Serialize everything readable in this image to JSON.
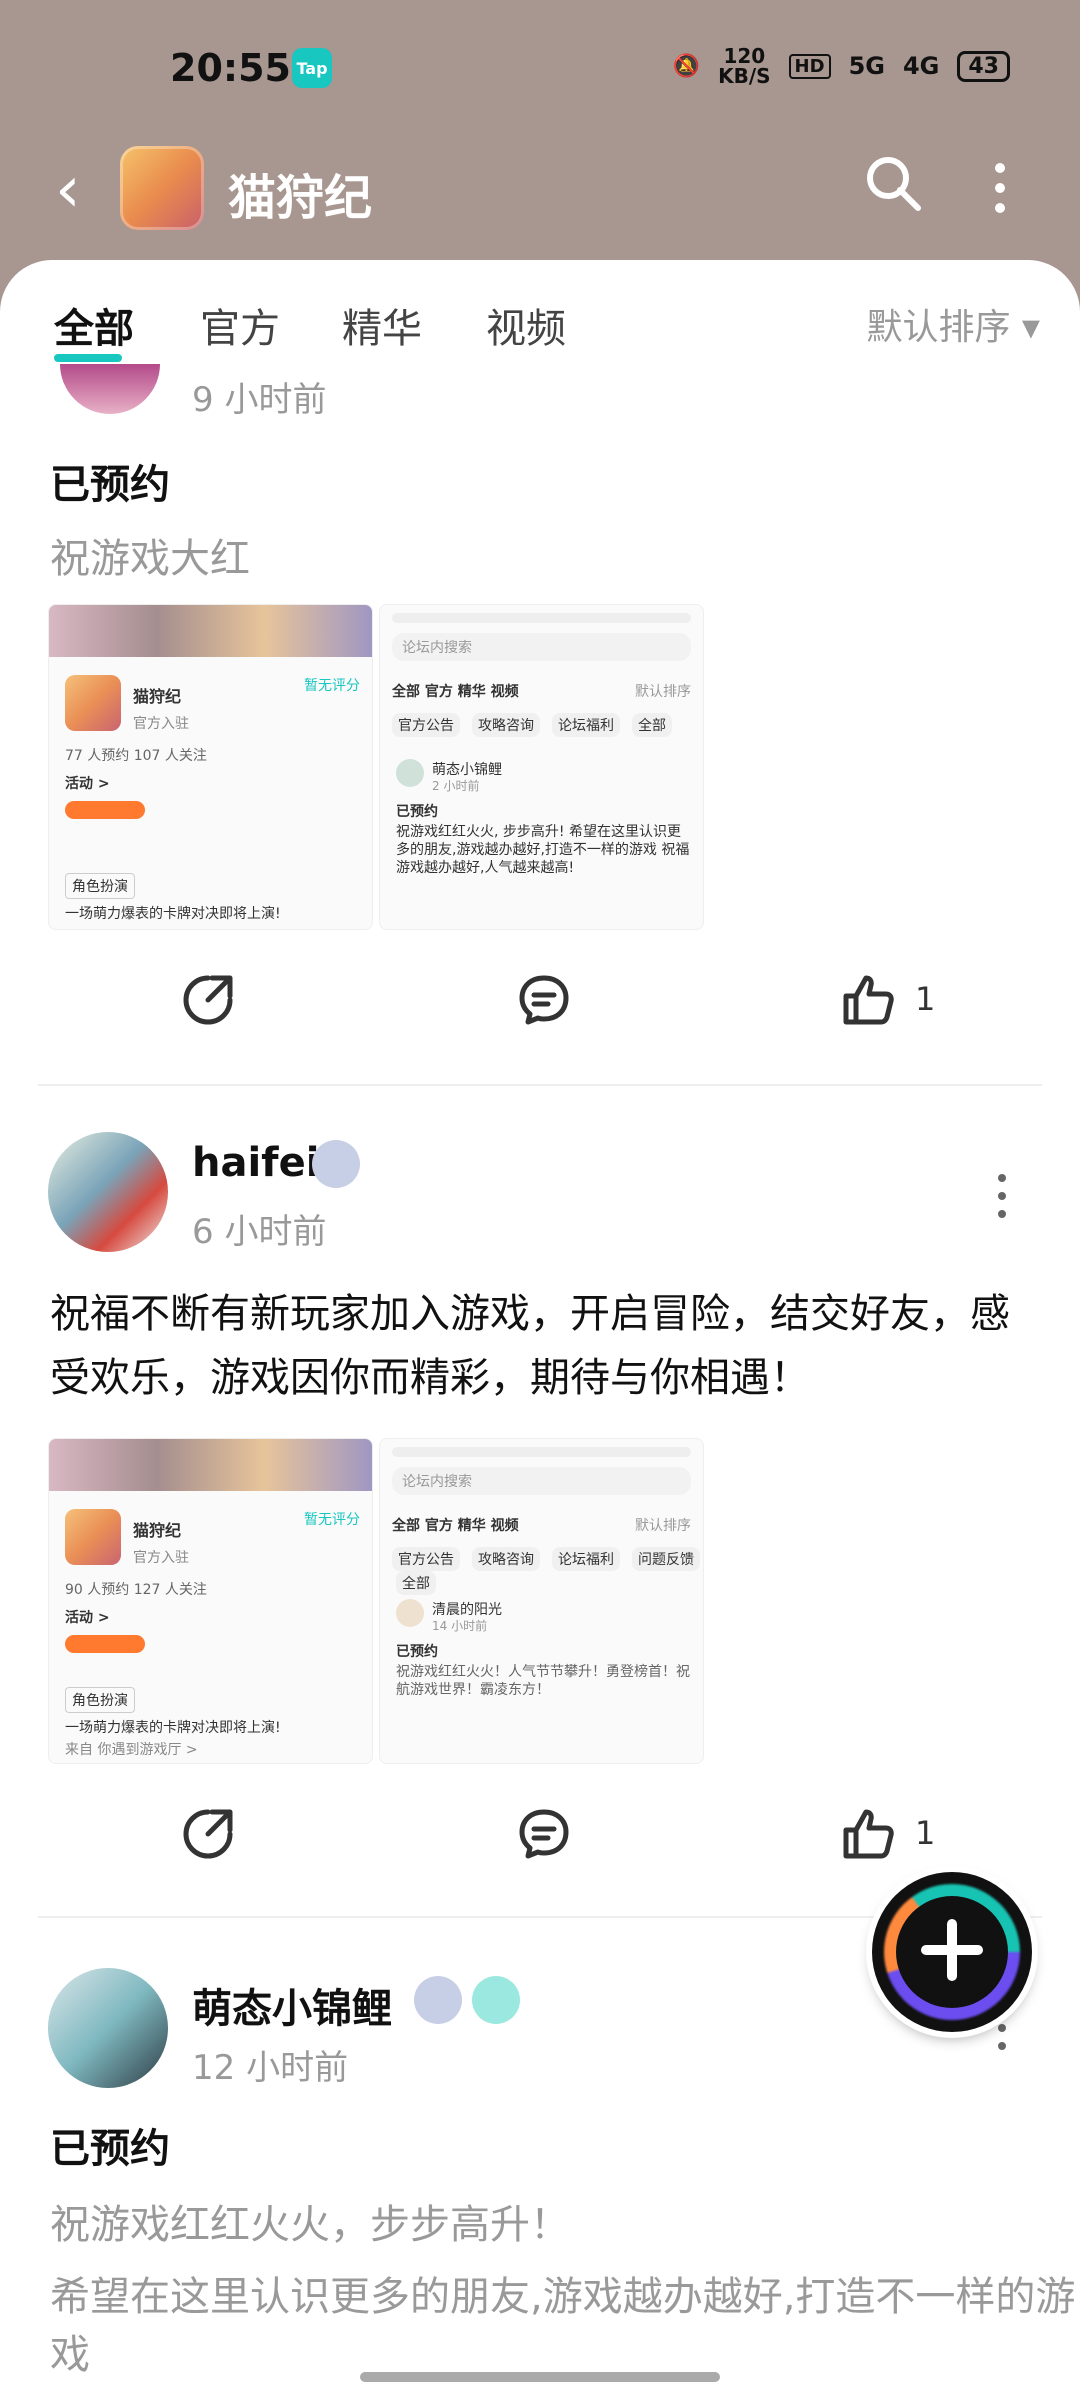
{
  "status": {
    "time": "20:55",
    "tap_badge": "Tap",
    "speed_top": "120",
    "speed_unit": "KB/S",
    "hd_label": "HD",
    "signal1": "5G",
    "signal2": "4G",
    "battery": "43"
  },
  "header": {
    "title": "猫狩纪"
  },
  "tabs": [
    {
      "label": "全部"
    },
    {
      "label": "官方"
    },
    {
      "label": "精华"
    },
    {
      "label": "视频"
    }
  ],
  "sort_label": "默认排序",
  "posts": [
    {
      "time": "9 小时前",
      "title": "已预约",
      "body": "祝游戏大红",
      "like_count": "1",
      "thumb_left": {
        "title": "猫狩纪",
        "score": "暂无评分",
        "sub": "官方入驻",
        "stats": "77 人预约    107 人关注",
        "event": "活动 >",
        "tag": "角色扮演",
        "desc": "一场萌力爆表的卡牌对决即将上演!"
      },
      "thumb_right": {
        "search": "论坛内搜索",
        "tabs": "全部  官方  精华  视频",
        "sort": "默认排序",
        "chips": [
          "官方公告",
          "攻略咨询",
          "论坛福利",
          "全部"
        ],
        "user": "萌态小锦鲤",
        "time": "2 小时前",
        "title": "已预约",
        "text": "祝游戏红红火火, 步步高升! 希望在这里认识更多的朋友,游戏越办越好,打造不一样的游戏 祝福游戏越办越好,人气越来越高!"
      }
    },
    {
      "user": "haifei",
      "time": "6 小时前",
      "body": "祝福不断有新玩家加入游戏，开启冒险，结交好友，感受欢乐，游戏因你而精彩，期待与你相遇！",
      "like_count": "1",
      "thumb_left": {
        "title": "猫狩纪",
        "score": "暂无评分",
        "sub": "官方入驻",
        "stats": "90 人预约    127 人关注",
        "event": "活动 >",
        "tag": "角色扮演",
        "desc": "一场萌力爆表的卡牌对决即将上演!",
        "from": "来自  你遇到游戏厅 >"
      },
      "thumb_right": {
        "search": "论坛内搜索",
        "tabs": "全部  官方  精华  视频",
        "sort": "默认排序",
        "chips": [
          "官方公告",
          "攻略咨询",
          "论坛福利",
          "问题反馈",
          "全部"
        ],
        "user": "清晨的阳光",
        "time": "14 小时前",
        "title": "已预约",
        "text": "祝游戏红红火火！人气节节攀升！勇登榜首！祝航游戏世界！霸凌东方！"
      }
    },
    {
      "user": "萌态小锦鲤",
      "time": "12 小时前",
      "title": "已预约",
      "line1": "祝游戏红红火火，步步高升！",
      "line2": "希望在这里认识更多的朋友,游戏越办越好,打造不一样的游戏"
    }
  ],
  "colors": {
    "accent": "#18c7c0",
    "header_bg": "#a79790"
  }
}
